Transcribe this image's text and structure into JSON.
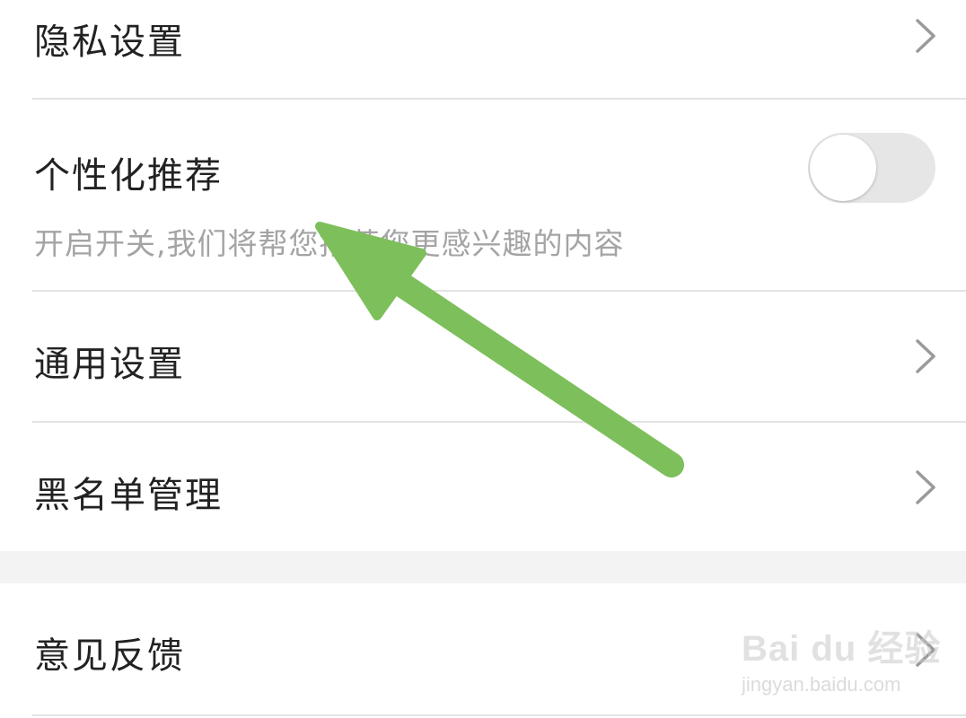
{
  "settings": {
    "privacy": {
      "label": "隐私设置"
    },
    "personalized": {
      "label": "个性化推荐",
      "description": "开启开关,我们将帮您推荐您更感兴趣的内容",
      "toggle_on": false
    },
    "general": {
      "label": "通用设置"
    },
    "blacklist": {
      "label": "黑名单管理"
    },
    "feedback": {
      "label": "意见反馈"
    }
  },
  "watermark": {
    "brand": "Bai du 经验",
    "url": "jingyan.baidu.com"
  },
  "colors": {
    "annotation_arrow": "#7dbf5b",
    "divider": "#e3e3e3",
    "section_gap": "#f3f3f3",
    "toggle_off_track": "#e6e6e6"
  },
  "icons": {
    "row_chevron": "chevron-right-icon",
    "annotation": "arrow-annotation-icon"
  }
}
